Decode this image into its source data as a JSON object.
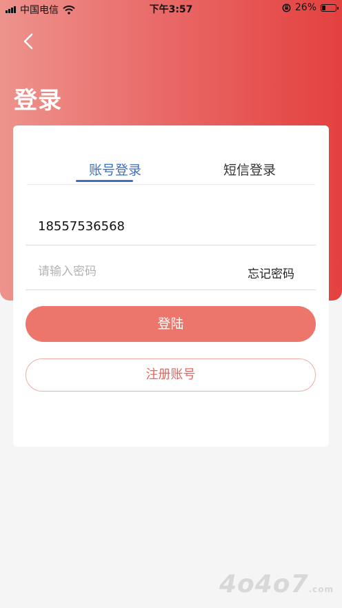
{
  "status_bar": {
    "carrier": "中国电信",
    "time": "下午3:57",
    "battery_percent": "26%",
    "battery_level": 0.26,
    "icons": [
      "signal-icon",
      "wifi-icon",
      "orientation-lock-icon",
      "battery-icon"
    ]
  },
  "header": {
    "back_icon": "chevron-left-icon",
    "title": "登录"
  },
  "tabs": [
    {
      "label": "账号登录",
      "active": true
    },
    {
      "label": "短信登录",
      "active": false
    }
  ],
  "form": {
    "phone_value": "18557536568",
    "password_placeholder": "请输入密码",
    "forgot_label": "忘记密码"
  },
  "buttons": {
    "login_label": "登陆",
    "register_label": "注册账号"
  },
  "watermark": {
    "text": "4o4o7",
    "suffix": ".com"
  },
  "colors": {
    "gradient_start": "#ee938d",
    "gradient_end": "#e3413f",
    "tab_active": "#3b6fc2",
    "login_button": "#ec756c",
    "register_border": "#f0aaa4"
  }
}
